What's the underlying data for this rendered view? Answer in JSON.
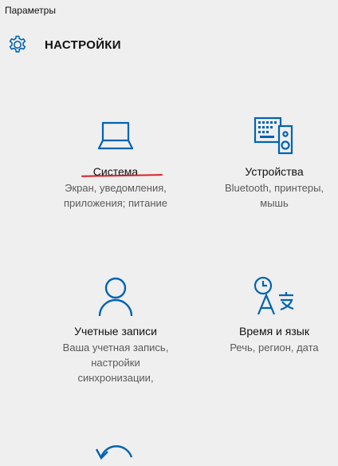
{
  "window": {
    "title": "Параметры"
  },
  "header": {
    "title": "НАСТРОЙКИ",
    "icon": "gear-icon"
  },
  "colors": {
    "accent": "#0063b1",
    "background": "#efefef",
    "description": "#5a5a5a",
    "underline": "#d8202a"
  },
  "tiles": [
    {
      "title": "Система",
      "icon": "laptop-icon",
      "desc_lines": [
        "Экран, уведомления,",
        "приложения; питание"
      ]
    },
    {
      "title": "Устройства",
      "icon": "devices-icon",
      "desc_lines": [
        "Bluetooth, принтеры,",
        "мышь"
      ]
    },
    {
      "title": "Учетные записи",
      "icon": "person-icon",
      "desc_lines": [
        "Ваша учетная запись,",
        "настройки",
        "синхронизации,"
      ]
    },
    {
      "title": "Время и язык",
      "icon": "time-language-icon",
      "desc_lines": [
        "Речь, регион, дата"
      ]
    },
    {
      "title": "",
      "icon": "update-icon",
      "desc_lines": []
    }
  ]
}
